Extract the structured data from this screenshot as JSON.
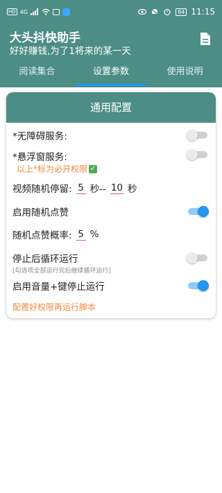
{
  "statusbar": {
    "hd": "HD",
    "signal": "4G",
    "battery": "84",
    "time": "11:15"
  },
  "app": {
    "title": "大头抖快助手",
    "subtitle": "好好赚钱,为了1将来的某一天",
    "doc_icon": "document-icon"
  },
  "tabs": [
    {
      "label": "阅读集合"
    },
    {
      "label": "设置参数"
    },
    {
      "label": "使用说明"
    }
  ],
  "card": {
    "header": "通用配置",
    "accessibility_label": "*无障碍服务:",
    "accessibility_on": false,
    "float_label": "*悬浮窗服务:",
    "float_on": false,
    "perm_note": "以上*标为必开权限",
    "stay": {
      "prefix": "视频随机停留:",
      "min": "5",
      "mid": "秒--",
      "max": "10",
      "suffix": "秒"
    },
    "random_like_label": "启用随机点赞",
    "random_like_on": true,
    "like_rate": {
      "prefix": "随机点赞概率:",
      "value": "5",
      "suffix": "%"
    },
    "loop_label": "停止后循环运行",
    "loop_on": false,
    "loop_hint": "[勾选项全部运行完后继续循环运行]",
    "volume_label": "启用音量+键停止运行",
    "volume_on": true,
    "footer_note": "配置好权限再运行脚本"
  },
  "colors": {
    "primary": "#4c8d85",
    "accent": "#2196f3",
    "orange": "#f0893a"
  }
}
